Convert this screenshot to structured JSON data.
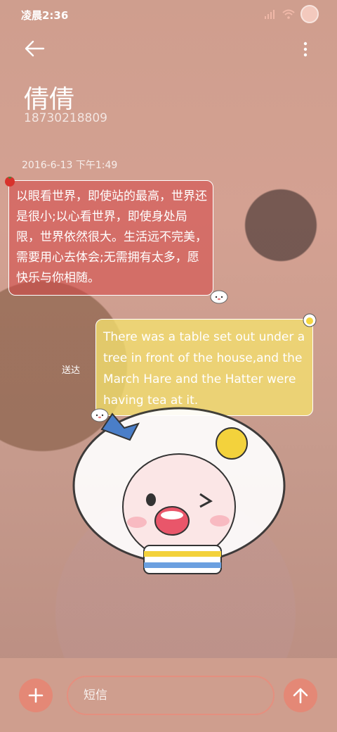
{
  "status_bar": {
    "time": "凌晨2:36"
  },
  "header": {
    "contact_name": "倩倩",
    "contact_number": "18730218809"
  },
  "conversation": {
    "timestamp": "2016-6-13 下午1:49",
    "messages": [
      {
        "direction": "incoming",
        "text": "以眼看世界，即使站的最高，世界还是很小;以心看世界，即使身处局限，世界依然很大。生活远不完美，需要用心去体会;无需拥有太多，愿快乐与你相随。"
      },
      {
        "direction": "outgoing",
        "text": "There was a table set out under a tree in front of the house,and the March Hare and the Hatter were having tea at it.",
        "status": "送达"
      }
    ]
  },
  "composer": {
    "placeholder": "短信"
  },
  "icons": {
    "back": "back-arrow-icon",
    "more": "more-vertical-icon",
    "add": "plus-icon",
    "send": "send-arrow-icon"
  },
  "colors": {
    "background": "#d2a08f",
    "incoming_bubble": "#d64646",
    "outgoing_bubble": "#f5e16e",
    "accent": "#e48876"
  }
}
